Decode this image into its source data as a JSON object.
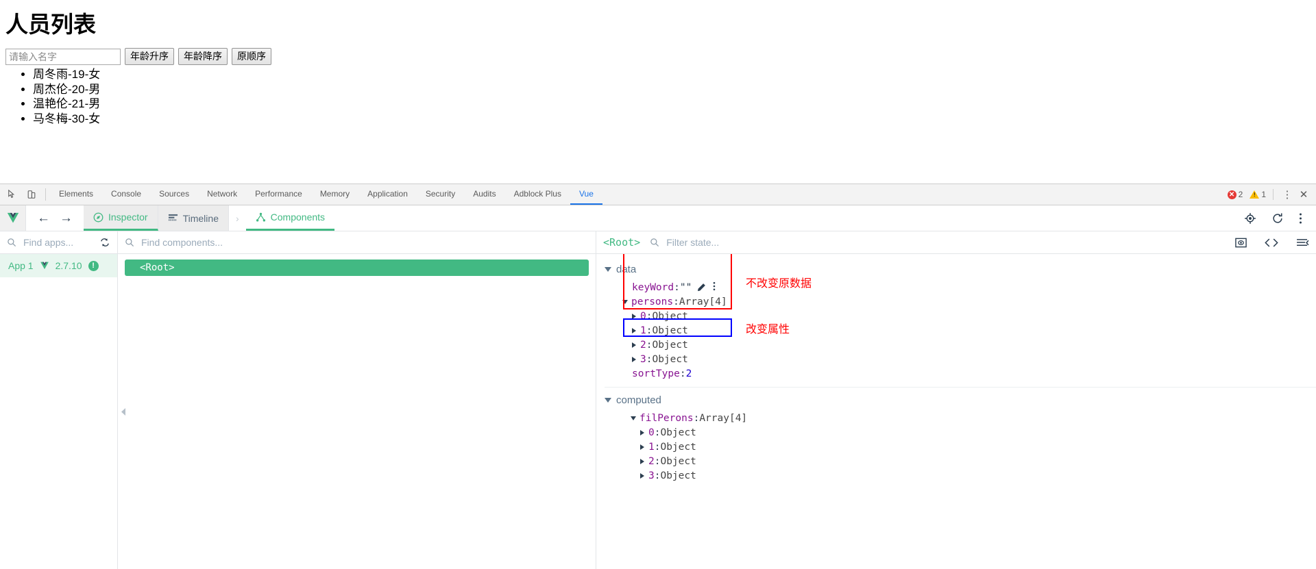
{
  "page": {
    "title": "人员列表",
    "search": {
      "placeholder": "请输入名字",
      "value": ""
    },
    "buttons": [
      {
        "label": "年龄升序",
        "name": "sort-age-asc-button"
      },
      {
        "label": "年龄降序",
        "name": "sort-age-desc-button"
      },
      {
        "label": "原顺序",
        "name": "sort-original-button"
      }
    ],
    "persons": [
      "周冬雨-19-女",
      "周杰伦-20-男",
      "温艳伦-21-男",
      "马冬梅-30-女"
    ]
  },
  "devtools": {
    "tabs": [
      "Elements",
      "Console",
      "Sources",
      "Network",
      "Performance",
      "Memory",
      "Application",
      "Security",
      "Audits",
      "Adblock Plus",
      "Vue"
    ],
    "active_tab": "Vue",
    "error_count": "2",
    "warning_count": "1",
    "more_label": "⋮",
    "close_label": "✕"
  },
  "vue_toolbar": {
    "inspector_label": "Inspector",
    "timeline_label": "Timeline",
    "components_label": "Components",
    "back_label": "←",
    "forward_label": "→",
    "chevron_label": "›"
  },
  "apps_panel": {
    "find_placeholder": "Find apps...",
    "app_name": "App 1",
    "vue_version": "2.7.10",
    "badge": "!"
  },
  "components_panel": {
    "find_placeholder": "Find components...",
    "root_label": "<Root>"
  },
  "state_panel": {
    "breadcrumb": "<Root>",
    "filter_placeholder": "Filter state...",
    "groups": [
      {
        "name": "data",
        "entries": [
          {
            "key": "keyWord",
            "sep": ": ",
            "value": "\"\"",
            "value_type": "str",
            "expandable": false,
            "tools": true
          },
          {
            "key": "persons",
            "sep": ": ",
            "value": "Array[4]",
            "value_type": "obj",
            "expandable": true,
            "expanded": true,
            "children": [
              {
                "key": "0",
                "sep": ": ",
                "value": "Object",
                "value_type": "obj"
              },
              {
                "key": "1",
                "sep": ": ",
                "value": "Object",
                "value_type": "obj"
              },
              {
                "key": "2",
                "sep": ": ",
                "value": "Object",
                "value_type": "obj"
              },
              {
                "key": "3",
                "sep": ": ",
                "value": "Object",
                "value_type": "obj"
              }
            ]
          },
          {
            "key": "sortType",
            "sep": ": ",
            "value": "2",
            "value_type": "num",
            "expandable": false
          }
        ]
      },
      {
        "name": "computed",
        "entries": [
          {
            "key": "filPerons",
            "sep": ": ",
            "value": "Array[4]",
            "value_type": "obj",
            "expandable": true,
            "expanded": true,
            "children": [
              {
                "key": "0",
                "sep": ": ",
                "value": "Object",
                "value_type": "obj"
              },
              {
                "key": "1",
                "sep": ": ",
                "value": "Object",
                "value_type": "obj"
              },
              {
                "key": "2",
                "sep": ": ",
                "value": "Object",
                "value_type": "obj"
              },
              {
                "key": "3",
                "sep": ": ",
                "value": "Object",
                "value_type": "obj"
              }
            ]
          }
        ]
      }
    ],
    "annotations": [
      {
        "text": "不改变原数据",
        "color": "#ff0000"
      },
      {
        "text": "改变属性",
        "color": "#ff0000"
      }
    ],
    "highlight_colors": {
      "persons_box": "#ff0000",
      "sorttype_box": "#0000ff"
    }
  }
}
